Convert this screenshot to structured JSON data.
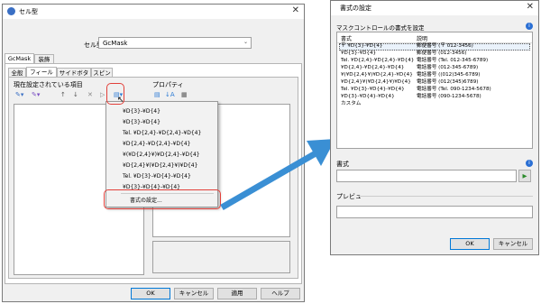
{
  "left_window": {
    "title": "セル型",
    "celltype_label": "セル型:",
    "celltype_value": "GcMask",
    "outer_tabs": [
      "GcMask",
      "装飾"
    ],
    "inner_tabs": [
      "全般",
      "フィールド",
      "サイドボタン",
      "スピン"
    ],
    "fields_group_label": "現在設定されている項目",
    "properties_label": "プロパティ",
    "format_menu": {
      "items": [
        "¥D{3}-¥D{4}",
        "¥D{3}-¥D{4}",
        "Tel. ¥D{2,4}-¥D{2,4}-¥D{4}",
        "¥D{2,4}-¥D{2,4}-¥D{4}",
        "¥(¥D{2,4}¥)¥D{2,4}-¥D{4}",
        "¥D{2,4}¥(¥D{2,4}¥)¥D{4}",
        "Tel. ¥D{3}-¥D{4}-¥D{4}",
        "¥D{3}-¥D{4}-¥D{4}"
      ],
      "settings_item": "書式の設定..."
    },
    "buttons": {
      "ok": "OK",
      "cancel": "キャンセル",
      "apply": "適用",
      "help": "ヘルプ"
    }
  },
  "right_window": {
    "title": "書式の設定",
    "description": "マスクコントロールの書式を設定",
    "table_headers": {
      "format": "書式",
      "explanation": "説明"
    },
    "rows": [
      {
        "format": "〒 ¥D{3}-¥D{4}",
        "explanation": "郵便番号 (〒 012-3456)"
      },
      {
        "format": "¥D{3}-¥D{4}",
        "explanation": "郵便番号 (012-3456)"
      },
      {
        "format": "Tel. ¥D{2,4}-¥D{2,4}-¥D{4}",
        "explanation": "電話番号 (Tel. 012-345-6789)"
      },
      {
        "format": "¥D{2,4}-¥D{2,4}-¥D{4}",
        "explanation": "電話番号 (012-345-6789)"
      },
      {
        "format": "¥(¥D{2,4}¥)¥D{2,4}-¥D{4}",
        "explanation": "電話番号 ((012)345-6789)"
      },
      {
        "format": "¥D{2,4}¥(¥D{2,4}¥)¥D{4}",
        "explanation": "電話番号 (012(345)6789)"
      },
      {
        "format": "Tel. ¥D{3}-¥D{4}-¥D{4}",
        "explanation": "電話番号 (Tel. 090-1234-5678)"
      },
      {
        "format": "¥D{3}-¥D{4}-¥D{4}",
        "explanation": "電話番号 (090-1234-5678)"
      },
      {
        "format": "カスタム",
        "explanation": ""
      }
    ],
    "format_label": "書式",
    "preview_label": "プレビュー",
    "buttons": {
      "ok": "OK",
      "cancel": "キャンセル"
    }
  },
  "colors": {
    "highlight": "#e2403a",
    "arrow": "#3a8fd4",
    "accent": "#0078d7"
  }
}
